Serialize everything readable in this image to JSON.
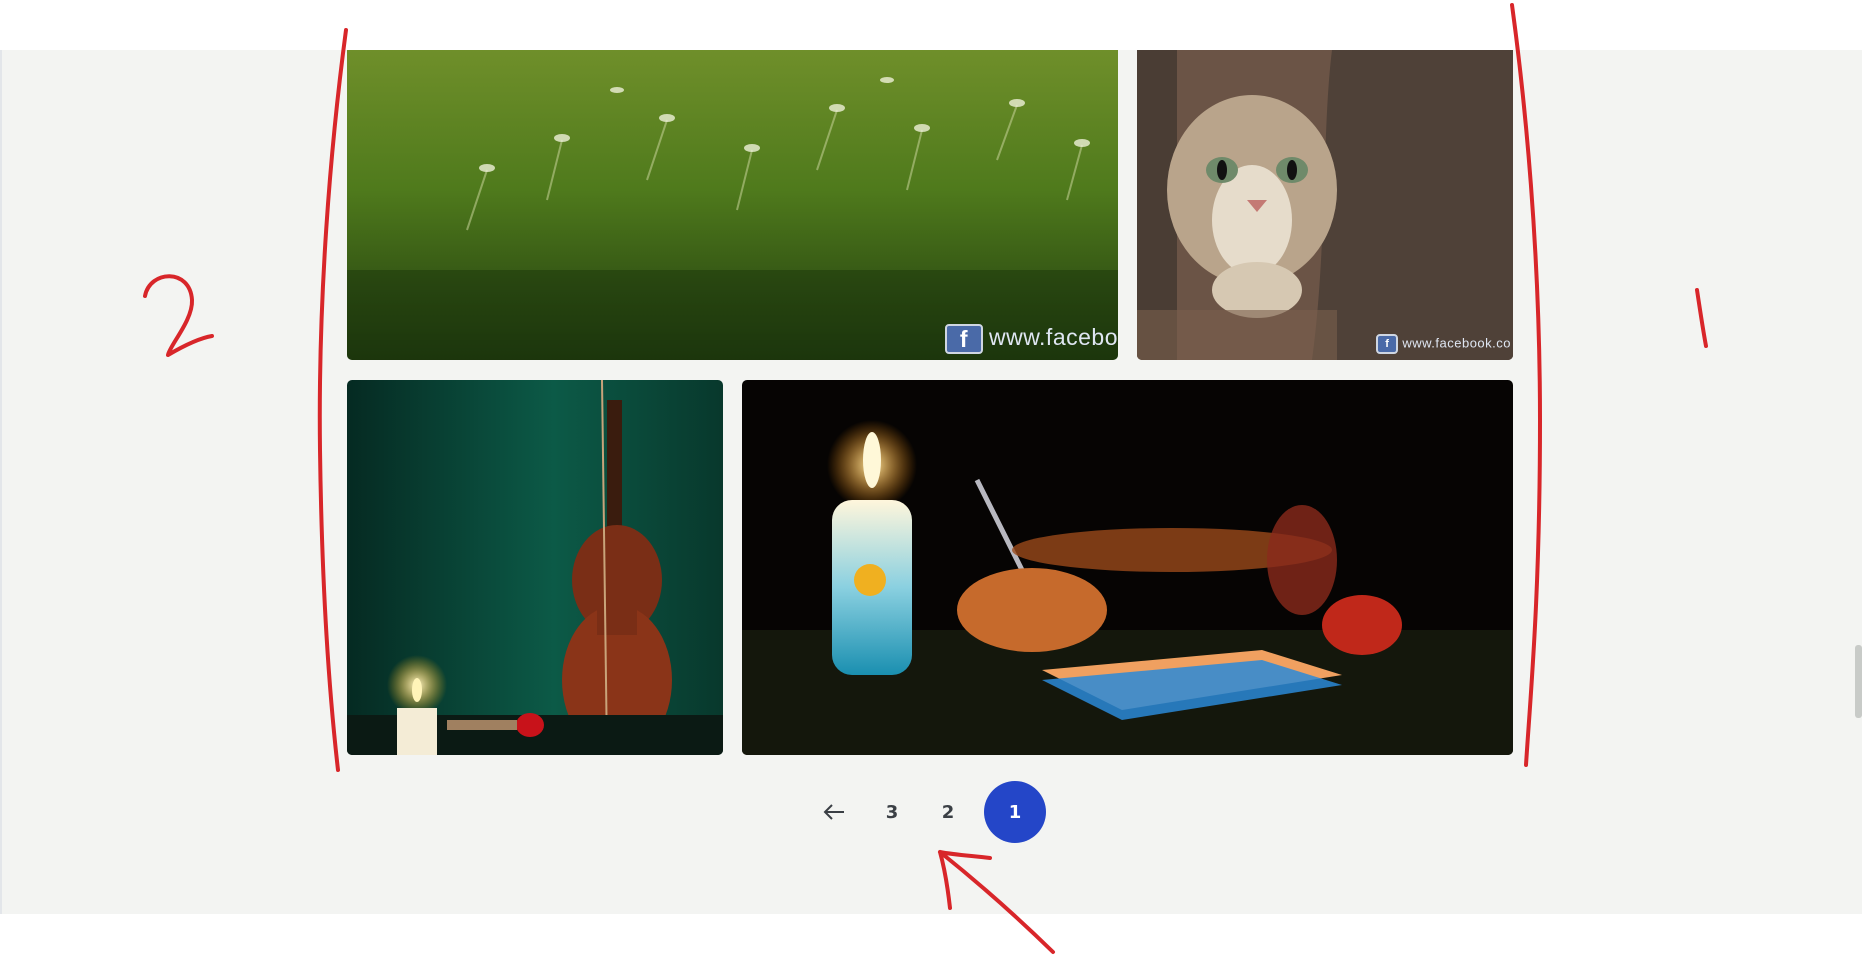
{
  "gallery": {
    "photos": [
      {
        "name": "grass-field",
        "watermark": "www.facebo",
        "watermark_icon": "f"
      },
      {
        "name": "cat-behind-tree",
        "watermark": "www.facebook.co",
        "watermark_icon": "f"
      },
      {
        "name": "violin-candle"
      },
      {
        "name": "candle-writing-hands"
      }
    ]
  },
  "pagination": {
    "prev_icon": "arrow-left-icon",
    "pages": [
      "3",
      "2",
      "1"
    ],
    "active_page": "1",
    "active_color": "#2446c8"
  },
  "annotations": {
    "left_label": "2",
    "right_label": "1",
    "stroke_color": "#d8262a"
  }
}
